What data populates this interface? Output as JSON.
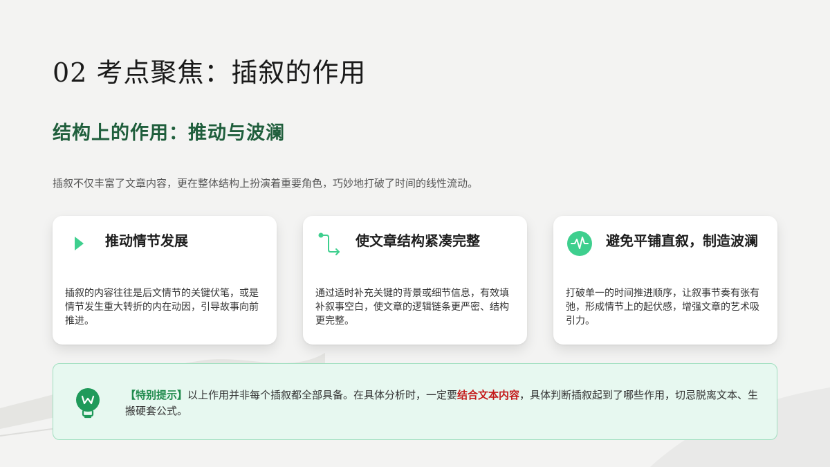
{
  "page": {
    "title": "02 考点聚焦：插叙的作用",
    "subtitle": "结构上的作用：推动与波澜",
    "intro": "插叙不仅丰富了文章内容，更在整体结构上扮演着重要角色，巧妙地打破了时间的线性流动。"
  },
  "cards": [
    {
      "icon": "play-triangle-icon",
      "title": "推动情节发展",
      "body": "插叙的内容往往是后文情节的关键伏笔，或是情节发生重大转折的内在动因，引导故事向前推进。"
    },
    {
      "icon": "route-arrow-icon",
      "title": "使文章结构紧凑完整",
      "body": "通过适时补充关键的背景或细节信息，有效填补叙事空白，使文章的逻辑链条更严密、结构更完整。"
    },
    {
      "icon": "pulse-wave-icon",
      "title": "避免平铺直叙，制造波澜",
      "body": "打破单一的时间推进顺序，让叙事节奏有张有弛，形成情节上的起伏感，增强文章的艺术吸引力。"
    }
  ],
  "tip": {
    "icon": "lightbulb-icon",
    "label": "【特别提示】",
    "text_1": "以上作用并非每个插叙都全部具备。在具体分析时，一定要",
    "emphasis": "结合文本内容",
    "text_2": "，具体判断插叙起到了哪些作用，切忌脱离文本、生搬硬套公式。"
  },
  "colors": {
    "accent_green": "#1f5e3c",
    "icon_green": "#3ecf8e",
    "tip_label": "#1f8a4c",
    "tip_emphasis": "#c41a1a",
    "tip_background": "#e7f8f0"
  }
}
